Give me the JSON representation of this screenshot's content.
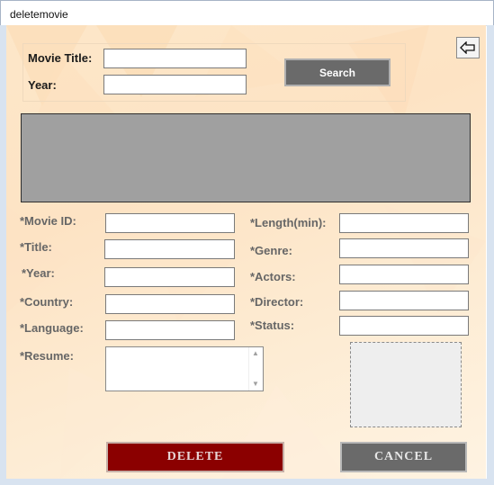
{
  "window": {
    "title": "deletemovie"
  },
  "search": {
    "movie_title_label": "Movie Title:",
    "movie_title_value": "",
    "year_label": "Year:",
    "year_value": "",
    "search_button": "Search"
  },
  "back_button": {
    "icon": "arrow-left-icon"
  },
  "fields_left": [
    {
      "label": "*Movie ID:",
      "value": ""
    },
    {
      "label": "*Title:",
      "value": ""
    },
    {
      "label": "*Year:",
      "value": ""
    },
    {
      "label": "*Country:",
      "value": ""
    },
    {
      "label": "*Language:",
      "value": ""
    }
  ],
  "fields_right": [
    {
      "label": "*Length(min):",
      "value": ""
    },
    {
      "label": "*Genre:",
      "value": ""
    },
    {
      "label": "*Actors:",
      "value": ""
    },
    {
      "label": "*Director:",
      "value": ""
    },
    {
      "label": "*Status:",
      "value": ""
    }
  ],
  "resume": {
    "label": "*Resume:",
    "value": ""
  },
  "actions": {
    "delete_label": "DELETE",
    "cancel_label": "CANCEL"
  },
  "colors": {
    "delete_button": "#8b0000",
    "neutral_button": "#6a6a6a",
    "results_grid": "#a0a0a0",
    "background": "#fde7c9"
  }
}
